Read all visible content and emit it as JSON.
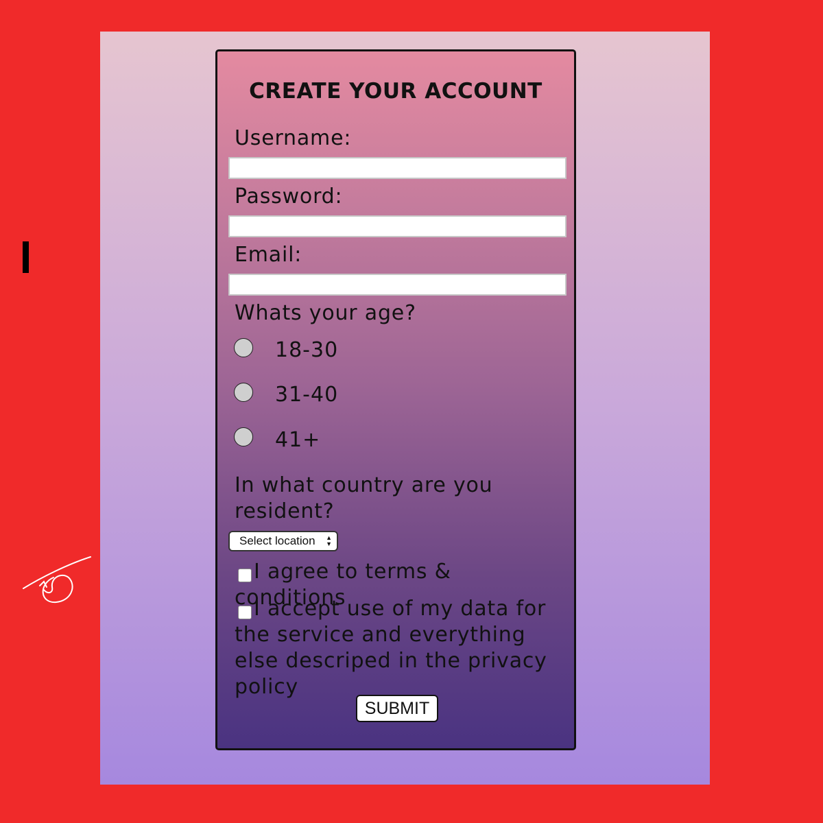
{
  "form": {
    "title": "CREATE YOUR ACCOUNT",
    "username_label": "Username:",
    "username_value": "",
    "password_label": "Password:",
    "password_value": "",
    "email_label": "Email:",
    "email_value": "",
    "age_question": "Whats your age?",
    "age_options": [
      "18-30",
      "31-40",
      "41+"
    ],
    "country_question": "In what country are you resident?",
    "country_select_value": "Select location",
    "terms_label": "I agree to terms & conditions",
    "terms_checked": false,
    "privacy_label": "I accept use of my data for the service and everything else descriped in the privacy policy",
    "privacy_checked": false,
    "submit_label": "SUBMIT"
  },
  "colors": {
    "outer_background": "#f02a2a",
    "card_gradient_top": "#e48aa0",
    "card_gradient_bottom": "#4a3381"
  },
  "icons": {
    "select_arrows": "up-down-arrows-icon"
  }
}
